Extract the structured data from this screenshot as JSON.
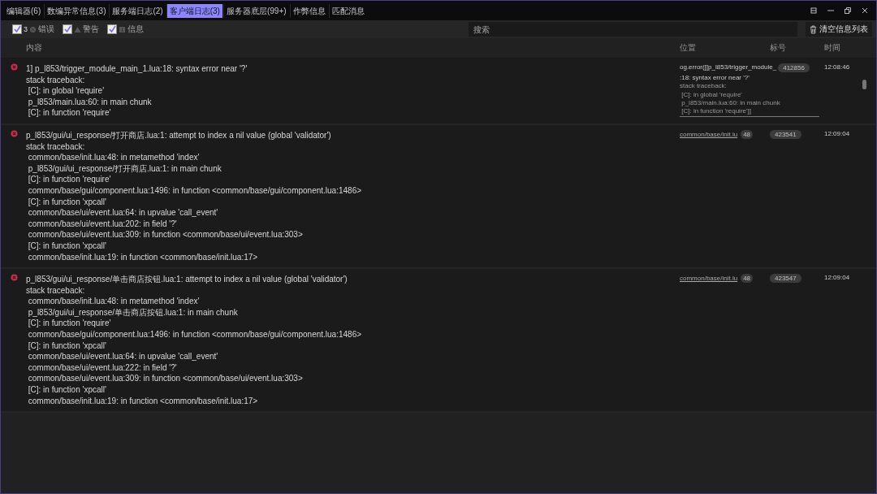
{
  "tabs": [
    {
      "label": "编辑器(6)",
      "selected": false
    },
    {
      "label": "数编异常信息(3)",
      "selected": false
    },
    {
      "label": "服务端日志(2)",
      "selected": false
    },
    {
      "label": "客户端日志(3)",
      "selected": true
    },
    {
      "label": "服务器底层(99+)",
      "selected": false
    },
    {
      "label": "作弊信息",
      "selected": false
    },
    {
      "label": "匹配消息",
      "selected": false
    }
  ],
  "filters": [
    {
      "kind": "error",
      "count": "3",
      "label": "错误",
      "checked": true
    },
    {
      "kind": "warning",
      "label": "警告",
      "checked": true
    },
    {
      "kind": "info",
      "label": "信息",
      "checked": true
    }
  ],
  "search": {
    "placeholder": "搜索"
  },
  "clear_button": "清空信息列表",
  "columns": [
    "内容",
    "位置",
    "标号",
    "时间"
  ],
  "rows": [
    {
      "kind": "inline",
      "lines": [
        "1] p_l853/trigger_module_main_1.lua:18: syntax error near '?'",
        "stack traceback:",
        " [C]: in global 'require'",
        " p_l853/main.lua:60: in main chunk",
        " [C]: in function 'require'"
      ],
      "location_lines": [
        "og.error([[p_l853/trigger_module_",
        ":18: syntax error near '?'",
        "stack traceback:",
        " [C]: in global 'require'",
        " p_l853/main.lua:60: in main chunk",
        " [C]: in function 'require']]"
      ],
      "number": "412856",
      "time": "12:08:46"
    },
    {
      "kind": "link",
      "lines": [
        "p_l853/gui/ui_response/打开商店.lua:1: attempt to index a nil value (global 'validator')",
        "stack traceback:",
        " common/base/init.lua:48: in metamethod 'index'",
        " p_l853/gui/ui_response/打开商店.lua:1: in main chunk",
        " [C]: in function 'require'",
        " common/base/gui/component.lua:1496: in function <common/base/gui/component.lua:1486>",
        " [C]: in function 'xpcall'",
        " common/base/ui/event.lua:64: in upvalue 'call_event'",
        " common/base/ui/event.lua:202: in field '?'",
        " common/base/ui/event.lua:309: in function <common/base/ui/event.lua:303>",
        " [C]: in function 'xpcall'",
        " common/base/init.lua:19: in function <common/base/init.lua:17>"
      ],
      "location": "common/base/init.lu",
      "line": "48",
      "number": "423541",
      "time": "12:09:04"
    },
    {
      "kind": "link",
      "lines": [
        "p_l853/gui/ui_response/单击商店按钮.lua:1: attempt to index a nil value (global 'validator')",
        "stack traceback:",
        " common/base/init.lua:48: in metamethod 'index'",
        " p_l853/gui/ui_response/单击商店按钮.lua:1: in main chunk",
        " [C]: in function 'require'",
        " common/base/gui/component.lua:1496: in function <common/base/gui/component.lua:1486>",
        " [C]: in function 'xpcall'",
        " common/base/ui/event.lua:64: in upvalue 'call_event'",
        " common/base/ui/event.lua:222: in field '?'",
        " common/base/ui/event.lua:309: in function <common/base/ui/event.lua:303>",
        " [C]: in function 'xpcall'",
        " common/base/init.lua:19: in function <common/base/init.lua:17>"
      ],
      "location": "common/base/init.lu",
      "line": "48",
      "number": "423547",
      "time": "12:09:04"
    }
  ]
}
